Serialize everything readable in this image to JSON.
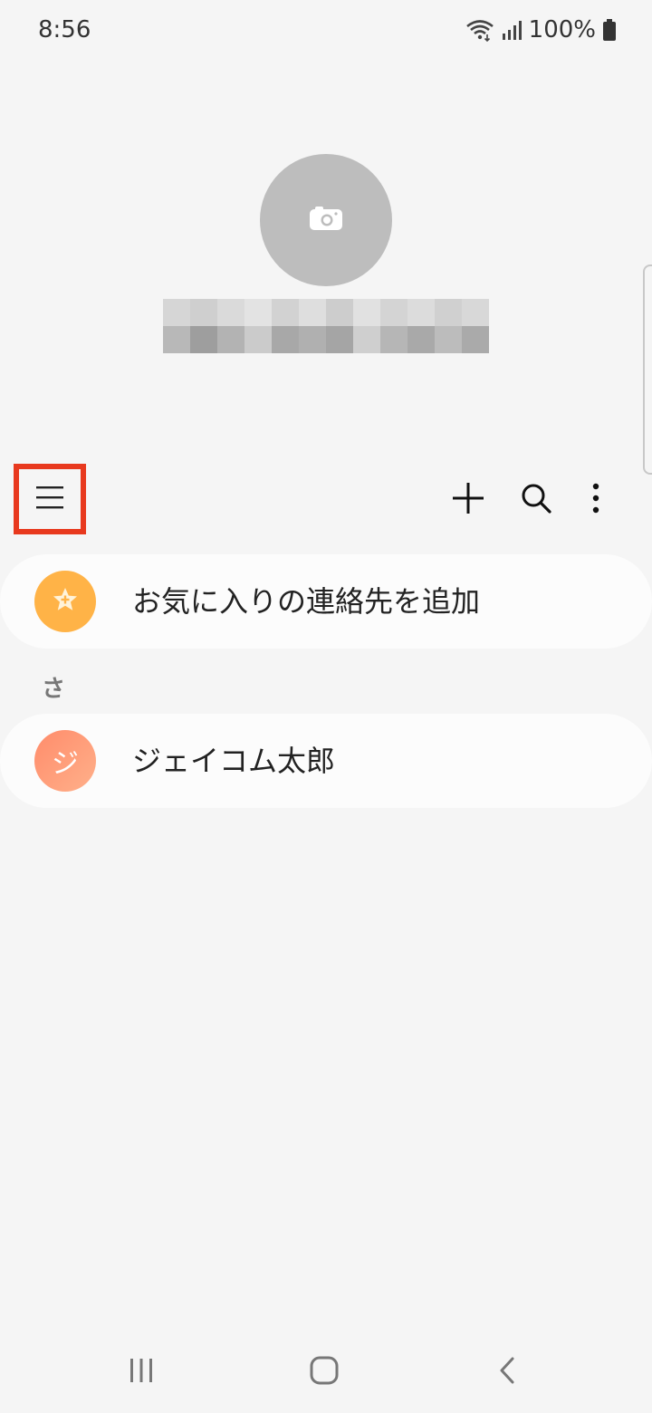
{
  "status_bar": {
    "time": "8:56",
    "battery": "100%",
    "icons": [
      "wifi-icon",
      "signal-icon",
      "battery-icon"
    ]
  },
  "profile": {
    "avatar_icon": "camera-icon",
    "name_redacted": true
  },
  "toolbar": {
    "icons": [
      "menu-icon",
      "plus-icon",
      "search-icon",
      "more-vert-icon"
    ],
    "highlight_color": "#e8391e"
  },
  "favorites": {
    "label": "お気に入りの連絡先を追加",
    "icon": "star-plus-icon",
    "icon_color": "#ffb347"
  },
  "section": {
    "letter": "さ"
  },
  "contacts": [
    {
      "initial": "ジ",
      "name": "ジェイコム太郎"
    }
  ],
  "nav_bar": {
    "icons": [
      "recents-icon",
      "home-icon",
      "back-icon"
    ]
  }
}
